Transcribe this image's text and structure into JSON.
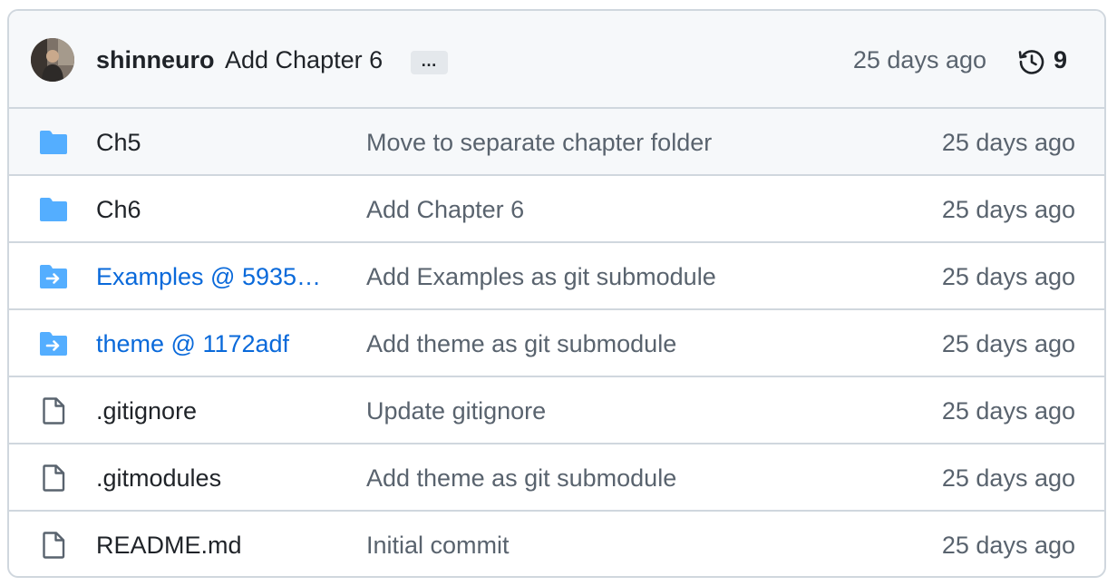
{
  "latest_commit": {
    "author": "shinneuro",
    "message": "Add Chapter 6",
    "ellipsis_label": "…",
    "time": "25 days ago",
    "commit_count": "9"
  },
  "colors": {
    "folder": "#54aeff",
    "link": "#0969da",
    "muted": "#59636e",
    "border": "#d0d7de",
    "header_bg": "#f6f8fa"
  },
  "files": [
    {
      "name": "Ch5",
      "type": "folder",
      "icon": "folder-icon",
      "message": "Move to separate chapter folder",
      "time": "25 days ago"
    },
    {
      "name": "Ch6",
      "type": "folder",
      "icon": "folder-icon",
      "message": "Add Chapter 6",
      "time": "25 days ago"
    },
    {
      "name": "Examples @ 5935…",
      "type": "submodule",
      "icon": "submodule-folder-icon",
      "message": "Add Examples as git submodule",
      "time": "25 days ago"
    },
    {
      "name": "theme @ 1172adf",
      "type": "submodule",
      "icon": "submodule-folder-icon",
      "message": "Add theme as git submodule",
      "time": "25 days ago"
    },
    {
      "name": ".gitignore",
      "type": "file",
      "icon": "file-icon",
      "message": "Update gitignore",
      "time": "25 days ago"
    },
    {
      "name": ".gitmodules",
      "type": "file",
      "icon": "file-icon",
      "message": "Add theme as git submodule",
      "time": "25 days ago"
    },
    {
      "name": "README.md",
      "type": "file",
      "icon": "file-icon",
      "message": "Initial commit",
      "time": "25 days ago"
    }
  ]
}
